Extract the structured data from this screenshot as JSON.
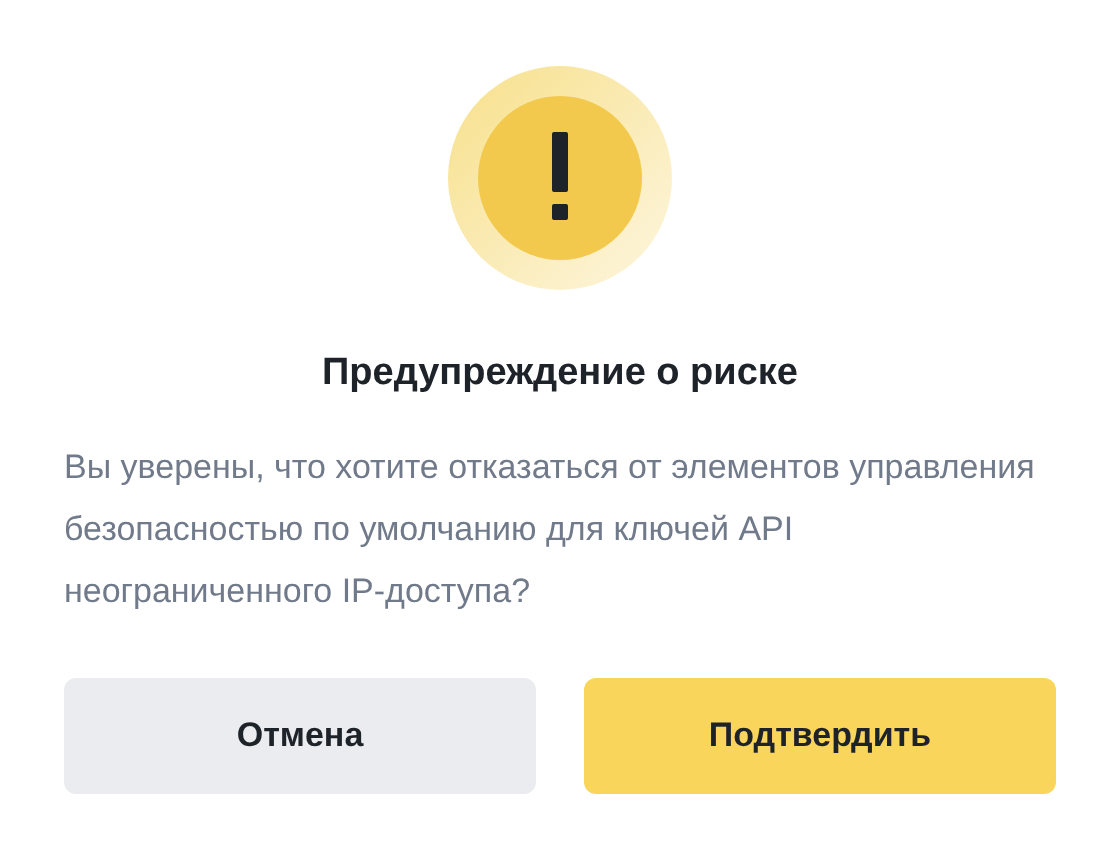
{
  "dialog": {
    "title": "Предупреждение о риске",
    "message": "Вы уверены, что хотите отказаться от элементов управления безопасностью по умолчанию для ключей API неограниченного IP-доступа?",
    "buttons": [
      {
        "label": "Отмена",
        "kind": "secondary"
      },
      {
        "label": "Подтвердить",
        "kind": "primary"
      }
    ]
  }
}
